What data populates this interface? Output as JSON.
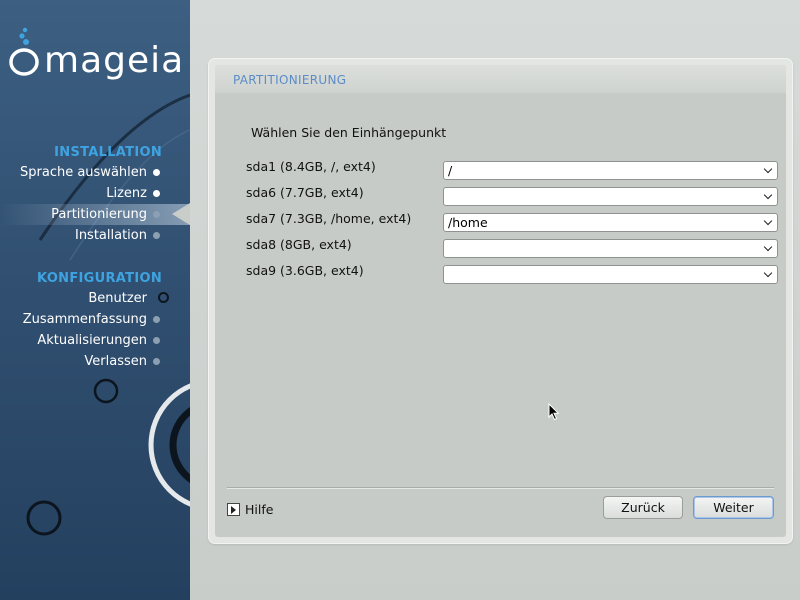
{
  "logo": {
    "text": "mageia"
  },
  "sidebar": {
    "sections": [
      {
        "title": "INSTALLATION"
      },
      {
        "title": "KONFIGURATION"
      }
    ],
    "items": [
      {
        "label": "Sprache auswählen",
        "state": "done"
      },
      {
        "label": "Lizenz",
        "state": "done"
      },
      {
        "label": "Partitionierung",
        "state": "active"
      },
      {
        "label": "Installation",
        "state": "pending"
      },
      {
        "label": "Benutzer",
        "state": "current-ring"
      },
      {
        "label": "Zusammenfassung",
        "state": "pending"
      },
      {
        "label": "Aktualisierungen",
        "state": "pending"
      },
      {
        "label": "Verlassen",
        "state": "pending"
      }
    ]
  },
  "panel": {
    "title": "PARTITIONIERUNG",
    "instruction": "Wählen Sie den Einhängepunkt",
    "partitions": [
      {
        "label": "sda1 (8.4GB, /, ext4)",
        "mount": "/"
      },
      {
        "label": "sda6 (7.7GB, ext4)",
        "mount": ""
      },
      {
        "label": "sda7 (7.3GB, /home, ext4)",
        "mount": "/home"
      },
      {
        "label": "sda8 (8GB, ext4)",
        "mount": ""
      },
      {
        "label": "sda9 (3.6GB, ext4)",
        "mount": ""
      }
    ],
    "help_label": "Hilfe",
    "back_label": "Zurück",
    "next_label": "Weiter"
  },
  "colors": {
    "sidebar": "#2f4d6e",
    "accent": "#3ea3e0",
    "panel_title": "#5b8cc6"
  },
  "icons": {
    "help": "play-triangle-icon",
    "select": "chevron-down-icon"
  }
}
